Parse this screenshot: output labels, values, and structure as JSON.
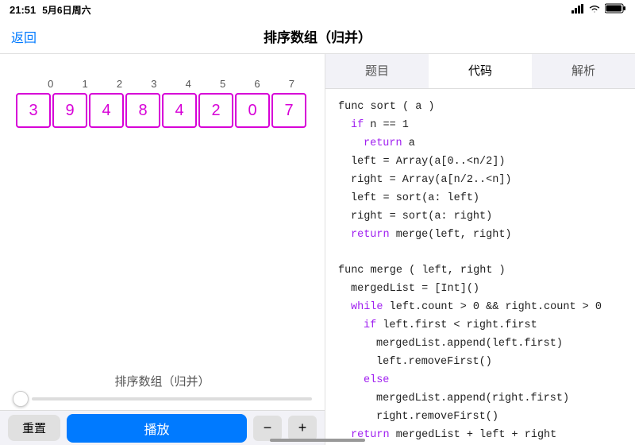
{
  "statusBar": {
    "time": "21:51",
    "date": "5月6日周六",
    "signal": "●●●●",
    "wifi": "WiFi",
    "battery": "100%"
  },
  "navBar": {
    "backLabel": "返回",
    "title": "排序数组（归并）"
  },
  "tabs": [
    {
      "label": "题目",
      "active": false
    },
    {
      "label": "代码",
      "active": true
    },
    {
      "label": "解析",
      "active": false
    }
  ],
  "arrayIndices": [
    "0",
    "1",
    "2",
    "3",
    "4",
    "5",
    "6",
    "7"
  ],
  "arrayValues": [
    "3",
    "9",
    "4",
    "8",
    "4",
    "2",
    "0",
    "7"
  ],
  "arrayLabel": "排序数组（归并）",
  "buttons": {
    "reset": "重置",
    "play": "播放",
    "minus": "−",
    "plus": "+"
  },
  "code": [
    {
      "text": "func sort ( a )",
      "indent": 0,
      "type": "normal"
    },
    {
      "text": "if n == 1",
      "indent": 1,
      "type": "keyword"
    },
    {
      "text": "return a",
      "indent": 2,
      "type": "return"
    },
    {
      "text": "left = Array(a[0..<n/2])",
      "indent": 1,
      "type": "normal"
    },
    {
      "text": "right = Array(a[n/2..<n])",
      "indent": 1,
      "type": "normal"
    },
    {
      "text": "left = sort(a: left)",
      "indent": 1,
      "type": "normal"
    },
    {
      "text": "right = sort(a: right)",
      "indent": 1,
      "type": "normal"
    },
    {
      "text": "return merge(left, right)",
      "indent": 1,
      "type": "return"
    },
    {
      "text": "",
      "indent": 0,
      "type": "blank"
    },
    {
      "text": "func merge ( left, right )",
      "indent": 0,
      "type": "normal"
    },
    {
      "text": "mergedList = [Int]()",
      "indent": 1,
      "type": "normal"
    },
    {
      "text": "while left.count > 0 && right.count > 0",
      "indent": 1,
      "type": "while"
    },
    {
      "text": "if left.first < right.first",
      "indent": 2,
      "type": "keyword"
    },
    {
      "text": "mergedList.append(left.first)",
      "indent": 3,
      "type": "normal"
    },
    {
      "text": "left.removeFirst()",
      "indent": 3,
      "type": "normal"
    },
    {
      "text": "else",
      "indent": 2,
      "type": "else"
    },
    {
      "text": "mergedList.append(right.first)",
      "indent": 3,
      "type": "normal"
    },
    {
      "text": "right.removeFirst()",
      "indent": 3,
      "type": "normal"
    },
    {
      "text": "return mergedList + left + right",
      "indent": 1,
      "type": "return"
    }
  ]
}
